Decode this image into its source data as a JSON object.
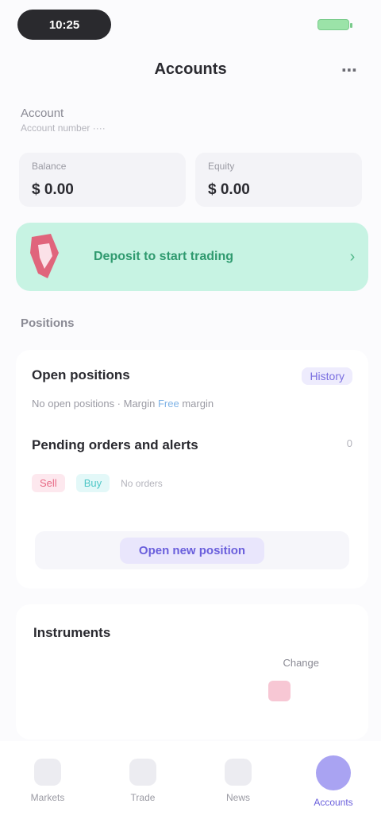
{
  "status_bar": {
    "time": "10:25"
  },
  "header": {
    "title": "Accounts",
    "more": "⋯"
  },
  "account": {
    "label": "Account",
    "sub": "Account number ····"
  },
  "summary": [
    {
      "caption": "Balance",
      "value": "$ 0.00"
    },
    {
      "caption": "Equity",
      "value": "$ 0.00"
    }
  ],
  "promo": {
    "text": "Deposit to start trading",
    "arrow": "›"
  },
  "section_label": "Positions",
  "positions": {
    "title": "Open positions",
    "tag": "History",
    "meta_left": "No open positions · Margin",
    "meta_blue": "Free",
    "meta_right": "margin",
    "sub_title": "Pending orders and alerts",
    "sub_right": "0",
    "chip_red": "Sell",
    "chip_teal": "Buy",
    "chip_grey": "No orders",
    "cta": "Open new position"
  },
  "lower": {
    "title": "Instruments",
    "caption": "Change"
  },
  "nav": [
    {
      "label": "Markets",
      "icon": "chart-icon"
    },
    {
      "label": "Trade",
      "icon": "swap-icon"
    },
    {
      "label": "News",
      "icon": "news-icon"
    },
    {
      "label": "Accounts",
      "icon": "user-icon",
      "active": true
    }
  ],
  "colors": {
    "accent": "#6a5fdc",
    "promo_bg": "#c7f3e3",
    "promo_text": "#2f9a6f"
  }
}
